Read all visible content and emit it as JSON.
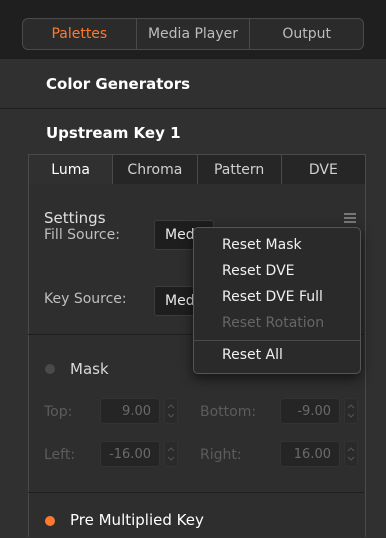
{
  "tabs": [
    {
      "label": "Palettes",
      "active": true
    },
    {
      "label": "Media Player",
      "active": false
    },
    {
      "label": "Output",
      "active": false
    }
  ],
  "sections": {
    "color_generators": "Color Generators",
    "upstream_key": "Upstream Key 1"
  },
  "key_tabs": [
    {
      "label": "Luma",
      "active": true
    },
    {
      "label": "Chroma",
      "active": false
    },
    {
      "label": "Pattern",
      "active": false
    },
    {
      "label": "DVE",
      "active": false
    }
  ],
  "settings": {
    "title": "Settings",
    "fill_source_label": "Fill Source:",
    "fill_source_value": "Med",
    "key_source_label": "Key Source:",
    "key_source_value": "Med"
  },
  "mask": {
    "label": "Mask",
    "top_label": "Top:",
    "top_value": "9.00",
    "bottom_label": "Bottom:",
    "bottom_value": "-9.00",
    "left_label": "Left:",
    "left_value": "-16.00",
    "right_label": "Right:",
    "right_value": "16.00"
  },
  "pre_multiplied": {
    "label": "Pre Multiplied Key"
  },
  "menu": {
    "items": [
      {
        "label": "Reset Mask",
        "enabled": true
      },
      {
        "label": "Reset DVE",
        "enabled": true
      },
      {
        "label": "Reset DVE Full",
        "enabled": true
      },
      {
        "label": "Reset Rotation",
        "enabled": false
      },
      {
        "label": "Reset All",
        "enabled": true
      }
    ]
  },
  "colors": {
    "accent": "#ff7a2f",
    "background": "#2b2b2b"
  }
}
